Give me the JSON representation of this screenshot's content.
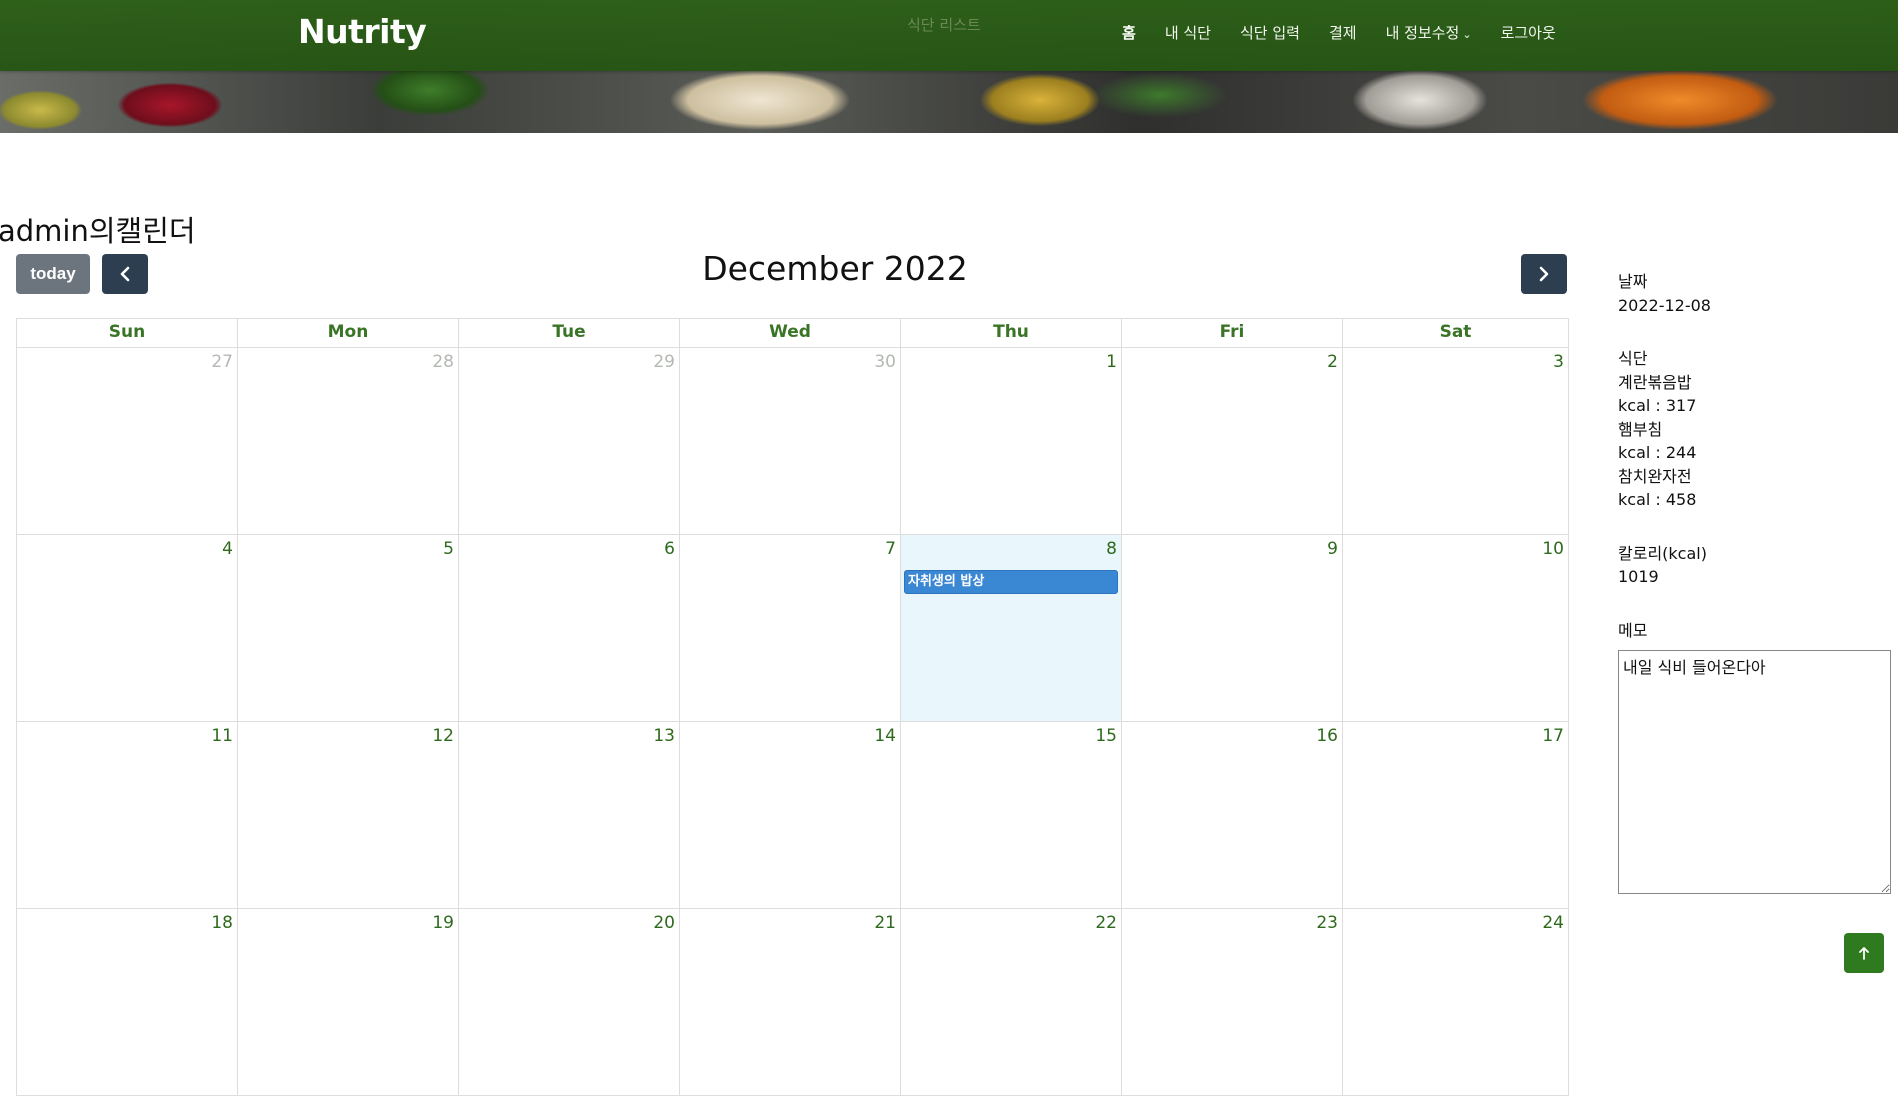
{
  "header": {
    "brand": "Nutrity",
    "faded_text": "식단 리스트",
    "nav": [
      {
        "label": "홈"
      },
      {
        "label": "내 식단"
      },
      {
        "label": "식단 입력"
      },
      {
        "label": "결제"
      },
      {
        "label": "내 정보수정",
        "dropdown": true
      },
      {
        "label": "로그아웃"
      }
    ]
  },
  "calendar": {
    "title": "admin의캘린더",
    "today_label": "today",
    "month_title": "December 2022",
    "weekdays": [
      "Sun",
      "Mon",
      "Tue",
      "Wed",
      "Thu",
      "Fri",
      "Sat"
    ],
    "weeks": [
      [
        {
          "d": "27",
          "other": true
        },
        {
          "d": "28",
          "other": true
        },
        {
          "d": "29",
          "other": true
        },
        {
          "d": "30",
          "other": true
        },
        {
          "d": "1"
        },
        {
          "d": "2"
        },
        {
          "d": "3"
        }
      ],
      [
        {
          "d": "4"
        },
        {
          "d": "5"
        },
        {
          "d": "6"
        },
        {
          "d": "7"
        },
        {
          "d": "8",
          "today": true,
          "event": "자취생의 밥상"
        },
        {
          "d": "9"
        },
        {
          "d": "10"
        }
      ],
      [
        {
          "d": "11"
        },
        {
          "d": "12"
        },
        {
          "d": "13"
        },
        {
          "d": "14"
        },
        {
          "d": "15"
        },
        {
          "d": "16"
        },
        {
          "d": "17"
        }
      ],
      [
        {
          "d": "18"
        },
        {
          "d": "19"
        },
        {
          "d": "20"
        },
        {
          "d": "21"
        },
        {
          "d": "22"
        },
        {
          "d": "23"
        },
        {
          "d": "24"
        }
      ]
    ],
    "event_color": "#3a87d4",
    "today_color": "#e9f6fb"
  },
  "detail": {
    "date_label": "날짜",
    "date_value": "2022-12-08",
    "meal_label": "식단",
    "meals": [
      {
        "name": "계란볶음밥",
        "kcal": "kcal : 317"
      },
      {
        "name": "햄부침",
        "kcal": "kcal : 244"
      },
      {
        "name": "참치완자전",
        "kcal": "kcal : 458"
      }
    ],
    "calorie_label": "칼로리(kcal)",
    "calorie_value": "1019",
    "memo_label": "메모",
    "memo_value": "내일 식비 들어온다아"
  },
  "colors": {
    "navbar": "#2d6018",
    "accent_green": "#3a7426",
    "nav_button": "#2c3e50",
    "today_button": "#6c757d"
  },
  "icons": {
    "prev": "chevron-left-icon",
    "next": "chevron-right-icon",
    "dropdown": "chevron-down-icon",
    "to_top": "arrow-up-icon"
  }
}
